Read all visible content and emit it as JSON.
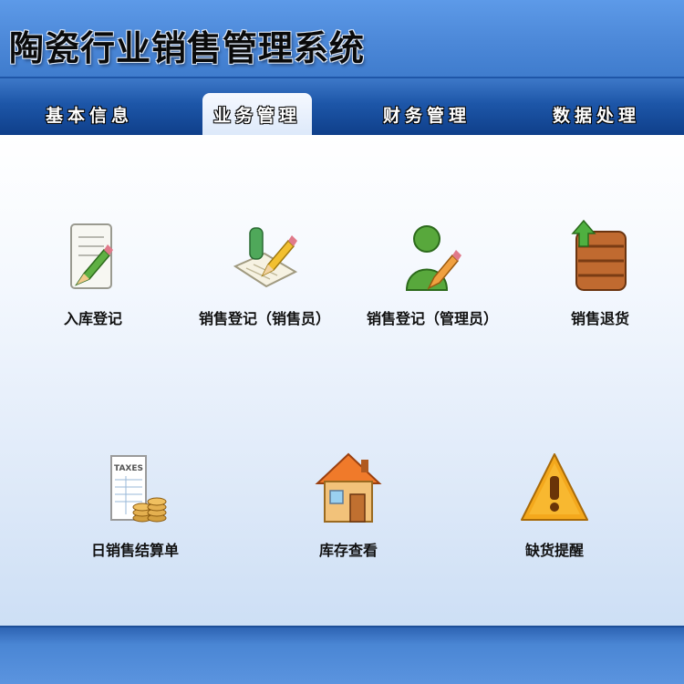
{
  "header": {
    "title": "陶瓷行业销售管理系统"
  },
  "tabs": [
    {
      "label": "基本信息",
      "active": false
    },
    {
      "label": "业务管理",
      "active": true
    },
    {
      "label": "财务管理",
      "active": false
    },
    {
      "label": "数据处理",
      "active": false
    }
  ],
  "items": [
    {
      "label": "入库登记",
      "icon": "document-pencil-icon"
    },
    {
      "label": "销售登记（销售员）",
      "icon": "notepad-pencil-icon"
    },
    {
      "label": "销售登记（管理员）",
      "icon": "user-pencil-icon"
    },
    {
      "label": "销售退货",
      "icon": "crate-return-icon"
    },
    {
      "label": "日销售结算单",
      "icon": "taxes-coins-icon",
      "icon_text": "TAXES"
    },
    {
      "label": "库存查看",
      "icon": "house-icon"
    },
    {
      "label": "缺货提醒",
      "icon": "warning-icon"
    }
  ],
  "colors": {
    "accent": "#4a86d4",
    "tab_bar": "#1d56a8",
    "warning": "#f0a020"
  }
}
